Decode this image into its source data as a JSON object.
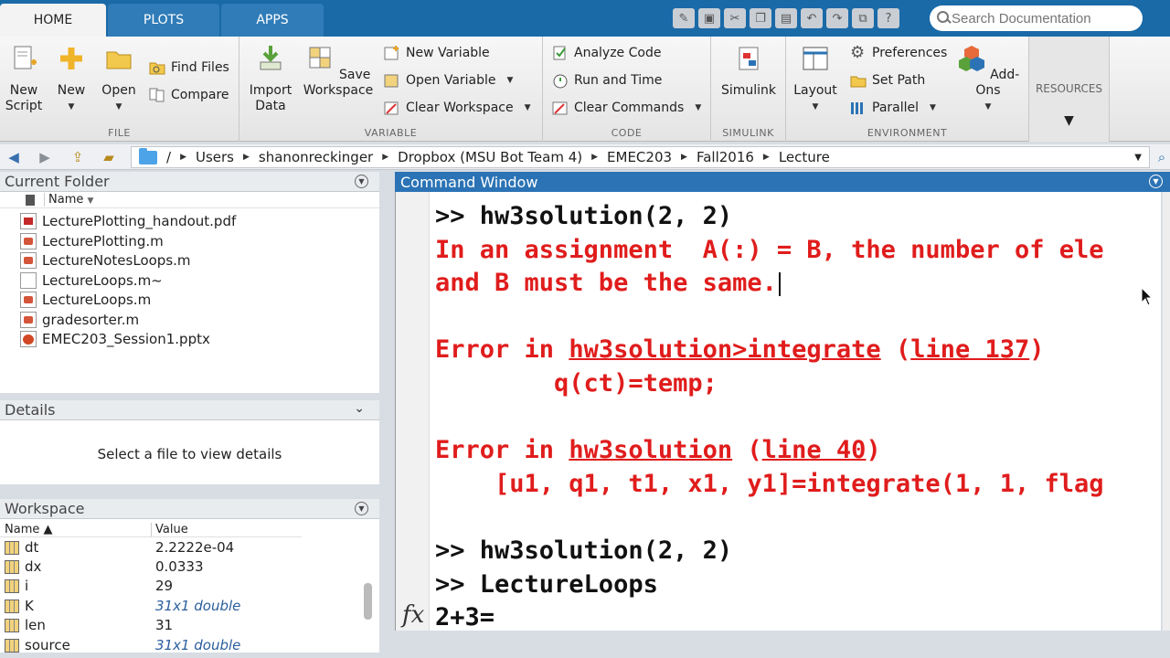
{
  "tabs": [
    {
      "label": "HOME",
      "active": true
    },
    {
      "label": "PLOTS",
      "active": false
    },
    {
      "label": "APPS",
      "active": false
    }
  ],
  "search": {
    "placeholder": "Search Documentation"
  },
  "ribbon": {
    "file": {
      "label": "FILE",
      "new_script": "New\nScript",
      "new": "New",
      "open": "Open",
      "find_files": "Find Files",
      "compare": "Compare"
    },
    "variable": {
      "label": "VARIABLE",
      "import_data": "Import\nData",
      "save_workspace": "Save\nWorkspace",
      "new_variable": "New Variable",
      "open_variable": "Open Variable",
      "clear_workspace": "Clear Workspace"
    },
    "code": {
      "label": "CODE",
      "analyze_code": "Analyze Code",
      "run_and_time": "Run and Time",
      "clear_commands": "Clear Commands"
    },
    "simulink": {
      "label": "SIMULINK",
      "simulink": "Simulink"
    },
    "environment": {
      "label": "ENVIRONMENT",
      "layout": "Layout",
      "preferences": "Preferences",
      "set_path": "Set Path",
      "parallel": "Parallel",
      "add_ons": "Add-Ons"
    },
    "resources": {
      "label": "RESOURCES"
    }
  },
  "address": {
    "path": [
      "/",
      "Users",
      "shanonreckinger",
      "Dropbox (MSU Bot Team 4)",
      "EMEC203",
      "Fall2016",
      "Lecture"
    ]
  },
  "current_folder": {
    "title": "Current Folder",
    "column_name": "Name",
    "files": [
      {
        "name": "LecturePlotting_handout.pdf",
        "type": "pdf"
      },
      {
        "name": "LecturePlotting.m",
        "type": "m"
      },
      {
        "name": "LectureNotesLoops.m",
        "type": "m"
      },
      {
        "name": "LectureLoops.m~",
        "type": "plain"
      },
      {
        "name": "LectureLoops.m",
        "type": "m"
      },
      {
        "name": "gradesorter.m",
        "type": "m"
      },
      {
        "name": "EMEC203_Session1.pptx",
        "type": "ppt"
      }
    ]
  },
  "details": {
    "title": "Details",
    "empty_text": "Select a file to view details"
  },
  "workspace": {
    "title": "Workspace",
    "col_name": "Name ▲",
    "col_value": "Value",
    "vars": [
      {
        "name": "dt",
        "value": "2.2222e-04",
        "italic": false
      },
      {
        "name": "dx",
        "value": "0.0333",
        "italic": false
      },
      {
        "name": "i",
        "value": "29",
        "italic": false
      },
      {
        "name": "K",
        "value": "31x1 double",
        "italic": true
      },
      {
        "name": "len",
        "value": "31",
        "italic": false
      },
      {
        "name": "source",
        "value": "31x1 double",
        "italic": true
      }
    ]
  },
  "command_window": {
    "title": "Command Window",
    "lines": [
      {
        "kind": "blk",
        "text": ">> hw3solution(2, 2)"
      },
      {
        "kind": "err",
        "text": "In an assignment  A(:) = B, the number of ele"
      },
      {
        "kind": "err",
        "text": "and B must be the same."
      },
      {
        "kind": "err",
        "text": ""
      },
      {
        "kind": "err",
        "pre": "Error in ",
        "link": "hw3solution>integrate",
        "mid": " (",
        "link2": "line 137",
        "post": ")"
      },
      {
        "kind": "err",
        "text": "        q(ct)=temp;"
      },
      {
        "kind": "err",
        "text": ""
      },
      {
        "kind": "err",
        "pre": "Error in ",
        "link": "hw3solution",
        "mid": " (",
        "link2": "line 40",
        "post": ")"
      },
      {
        "kind": "err",
        "text": "    [u1, q1, t1, x1, y1]=integrate(1, 1, flag"
      },
      {
        "kind": "err",
        "text": ""
      },
      {
        "kind": "blk",
        "text": ">> hw3solution(2, 2)"
      },
      {
        "kind": "blk",
        "text": ">> LectureLoops"
      },
      {
        "kind": "blk",
        "text": "2+3="
      }
    ],
    "fx_label": "fx"
  }
}
